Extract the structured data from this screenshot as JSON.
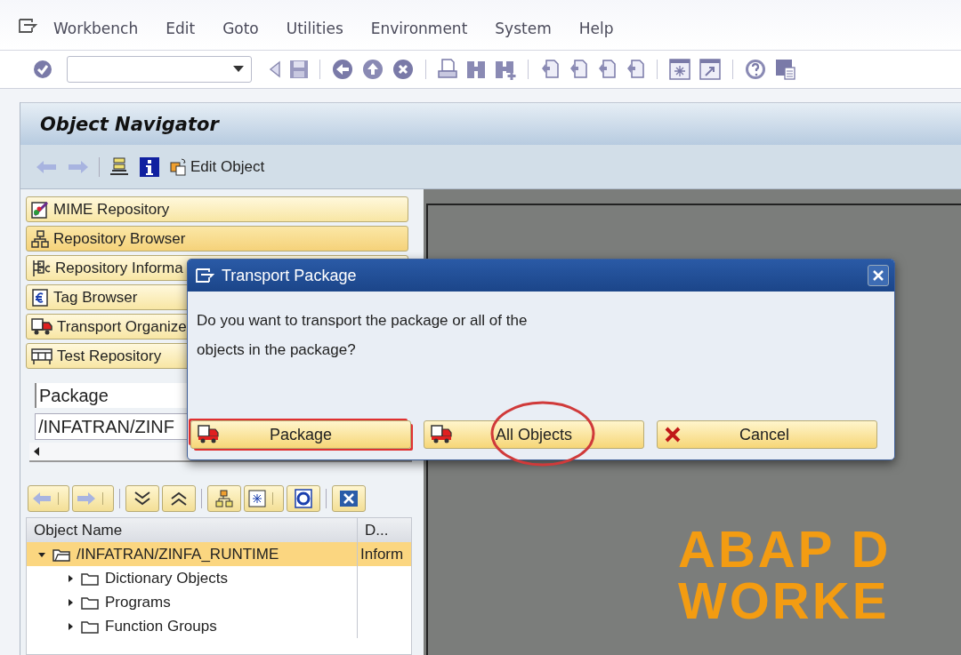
{
  "menu": [
    {
      "label": "Workbench"
    },
    {
      "label": "Edit"
    },
    {
      "label": "Goto"
    },
    {
      "label": "Utilities"
    },
    {
      "label": "Environment"
    },
    {
      "label": "System"
    },
    {
      "label": "Help"
    }
  ],
  "screen_title": "Object Navigator",
  "app_toolbar": {
    "edit_button": "Edit Object"
  },
  "navigation_buttons": [
    {
      "label": "MIME Repository",
      "kind": "mime",
      "selected": false
    },
    {
      "label": "Repository Browser",
      "kind": "browser",
      "selected": true
    },
    {
      "label": "Repository Informa",
      "kind": "info",
      "selected": false
    },
    {
      "label": "Tag Browser",
      "kind": "tag",
      "selected": false
    },
    {
      "label": "Transport Organize",
      "kind": "transport",
      "selected": false
    },
    {
      "label": "Test Repository",
      "kind": "test",
      "selected": false
    }
  ],
  "object_list_type": {
    "value": "Package"
  },
  "object_field": {
    "value": "/INFATRAN/ZINF"
  },
  "tree": {
    "columns": [
      "Object Name",
      "D..."
    ],
    "rows": [
      {
        "name": "/INFATRAN/ZINFA_RUNTIME",
        "description": "Inform",
        "expanded": true,
        "selected": true,
        "children": [
          {
            "name": "Dictionary Objects",
            "expanded": false,
            "selected": false
          },
          {
            "name": "Programs",
            "expanded": false,
            "selected": false
          },
          {
            "name": "Function Groups",
            "expanded": false,
            "selected": false
          }
        ]
      }
    ]
  },
  "logo": {
    "lines": [
      "ABAP D",
      "WORKE"
    ]
  },
  "dialog": {
    "title": "Transport Package",
    "message": "Do you want to transport the package or all of the objects in the package?",
    "buttons": [
      {
        "label": "Package",
        "kind": "truck",
        "focused": true,
        "circled": false
      },
      {
        "label": "All Objects",
        "kind": "truck",
        "focused": false,
        "circled": true
      },
      {
        "label": "Cancel",
        "kind": "cancel",
        "focused": false,
        "circled": false
      }
    ]
  }
}
